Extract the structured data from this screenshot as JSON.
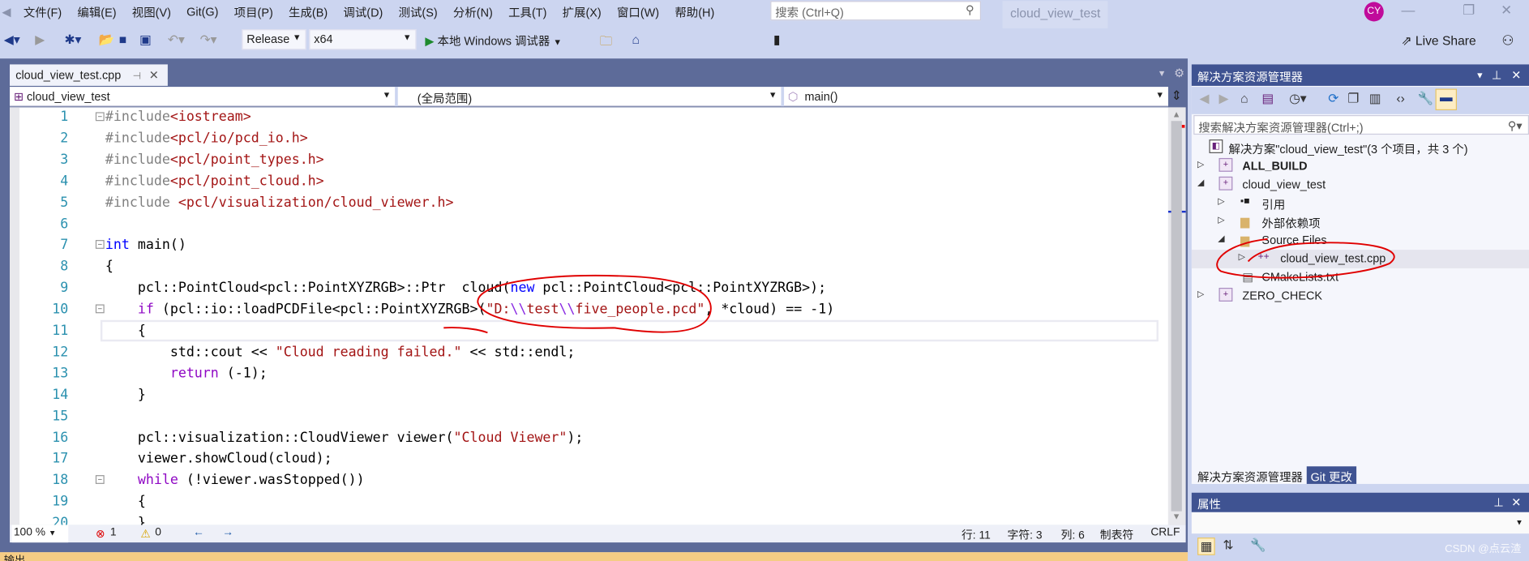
{
  "menu": [
    "文件(F)",
    "编辑(E)",
    "视图(V)",
    "Git(G)",
    "项目(P)",
    "生成(B)",
    "调试(D)",
    "测试(S)",
    "分析(N)",
    "工具(T)",
    "扩展(X)",
    "窗口(W)",
    "帮助(H)"
  ],
  "search_placeholder": "搜索 (Ctrl+Q)",
  "window_title": "cloud_view_test",
  "avatar": "CY",
  "toolbar": {
    "config": "Release",
    "platform": "x64",
    "debugger": "本地 Windows 调试器",
    "live_share": "Live Share"
  },
  "editor": {
    "tab": "cloud_view_test.cpp",
    "nav": {
      "project": "cloud_view_test",
      "scope": "(全局范围)",
      "member": "main()"
    },
    "lines": [
      [
        [
          "#include",
          "p"
        ],
        [
          "<iostream>",
          "s"
        ]
      ],
      [
        [
          "#include",
          "p"
        ],
        [
          "<pcl/io/pcd_io.h>",
          "s"
        ]
      ],
      [
        [
          "#include",
          "p"
        ],
        [
          "<pcl/point_types.h>",
          "s"
        ]
      ],
      [
        [
          "#include",
          "p"
        ],
        [
          "<pcl/point_cloud.h>",
          "s"
        ]
      ],
      [
        [
          "#include ",
          "p"
        ],
        [
          "<pcl/visualization/cloud_viewer.h>",
          "s"
        ]
      ],
      [],
      [
        [
          "int",
          "k"
        ],
        [
          " main()",
          ""
        ]
      ],
      [
        [
          "{",
          ""
        ]
      ],
      [
        [
          "    pcl::PointCloud<pcl::PointXYZRGB>::Ptr  cloud(",
          ""
        ],
        [
          "new",
          "k"
        ],
        [
          " pcl::PointCloud<pcl::PointXYZRGB>);",
          ""
        ]
      ],
      [
        [
          "    ",
          ""
        ],
        [
          "if",
          "c"
        ],
        [
          " (pcl::io::loadPCDFile<pcl::PointXYZRGB>(",
          ""
        ],
        [
          "\"D:",
          "s"
        ],
        [
          "\\\\",
          "e"
        ],
        [
          "test",
          "s"
        ],
        [
          "\\\\",
          "e"
        ],
        [
          "five_people.pcd\"",
          "s"
        ],
        [
          ", *cloud) == -1)",
          ""
        ]
      ],
      [
        [
          "    {",
          ""
        ]
      ],
      [
        [
          "        std::cout << ",
          ""
        ],
        [
          "\"Cloud reading failed.\"",
          "s"
        ],
        [
          " << std::endl;",
          ""
        ]
      ],
      [
        [
          "        ",
          ""
        ],
        [
          "return",
          "c"
        ],
        [
          " (-1);",
          ""
        ]
      ],
      [
        [
          "    }",
          ""
        ]
      ],
      [],
      [
        [
          "    pcl::visualization::CloudViewer viewer(",
          ""
        ],
        [
          "\"Cloud Viewer\"",
          "s"
        ],
        [
          ");",
          ""
        ]
      ],
      [
        [
          "    viewer.showCloud(cloud);",
          ""
        ]
      ],
      [
        [
          "    ",
          ""
        ],
        [
          "while",
          "c"
        ],
        [
          " (!viewer.wasStopped())",
          ""
        ]
      ],
      [
        [
          "    {",
          ""
        ]
      ],
      [
        [
          "    }",
          ""
        ]
      ]
    ]
  },
  "status": {
    "zoom": "100 %",
    "errors": "1",
    "warnings": "0",
    "line": "行: 11",
    "char": "字符: 3",
    "col": "列: 6",
    "tabs": "制表符",
    "eol": "CRLF"
  },
  "output_title": "输出",
  "solution_explorer": {
    "title": "解决方案资源管理器",
    "search_placeholder": "搜索解决方案资源管理器(Ctrl+;)",
    "items": [
      {
        "label": "解决方案\"cloud_view_test\"(3 个项目，共 3 个)"
      },
      {
        "label": "ALL_BUILD"
      },
      {
        "label": "cloud_view_test"
      },
      {
        "label": "引用"
      },
      {
        "label": "外部依赖项"
      },
      {
        "label": "Source Files"
      },
      {
        "label": "cloud_view_test.cpp"
      },
      {
        "label": "CMakeLists.txt"
      },
      {
        "label": "ZERO_CHECK"
      }
    ],
    "tabs": [
      "解决方案资源管理器",
      "Git 更改"
    ]
  },
  "properties": {
    "title": "属性"
  },
  "watermark": "CSDN @点云渣",
  "colors": {
    "accent": "#3f5392",
    "annotation": "#e00000",
    "avatar": "#c00b9b"
  }
}
